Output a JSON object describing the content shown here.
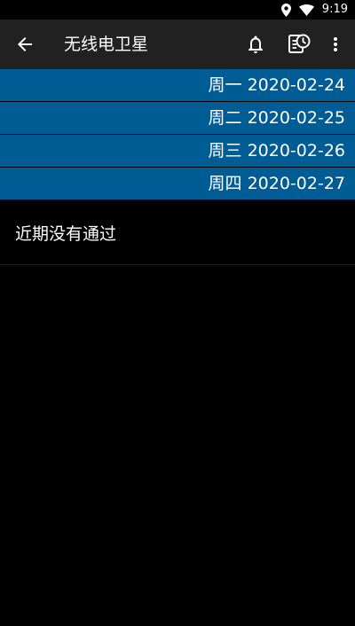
{
  "status_bar": {
    "time": "9:19",
    "icons": [
      "location-icon",
      "wifi-icon"
    ]
  },
  "app_bar": {
    "title": "无线电卫星",
    "icons": [
      "back-arrow-icon",
      "bell-icon",
      "schedule-icon",
      "more-vert-icon"
    ]
  },
  "dates": [
    {
      "label": "周一 2020-02-24"
    },
    {
      "label": "周二 2020-02-25"
    },
    {
      "label": "周三 2020-02-26"
    },
    {
      "label": "周四 2020-02-27"
    }
  ],
  "message": "近期没有通过",
  "colors": {
    "background": "#000000",
    "app_bar": "#212121",
    "date_row": "#005c94",
    "text": "#ffffff"
  }
}
